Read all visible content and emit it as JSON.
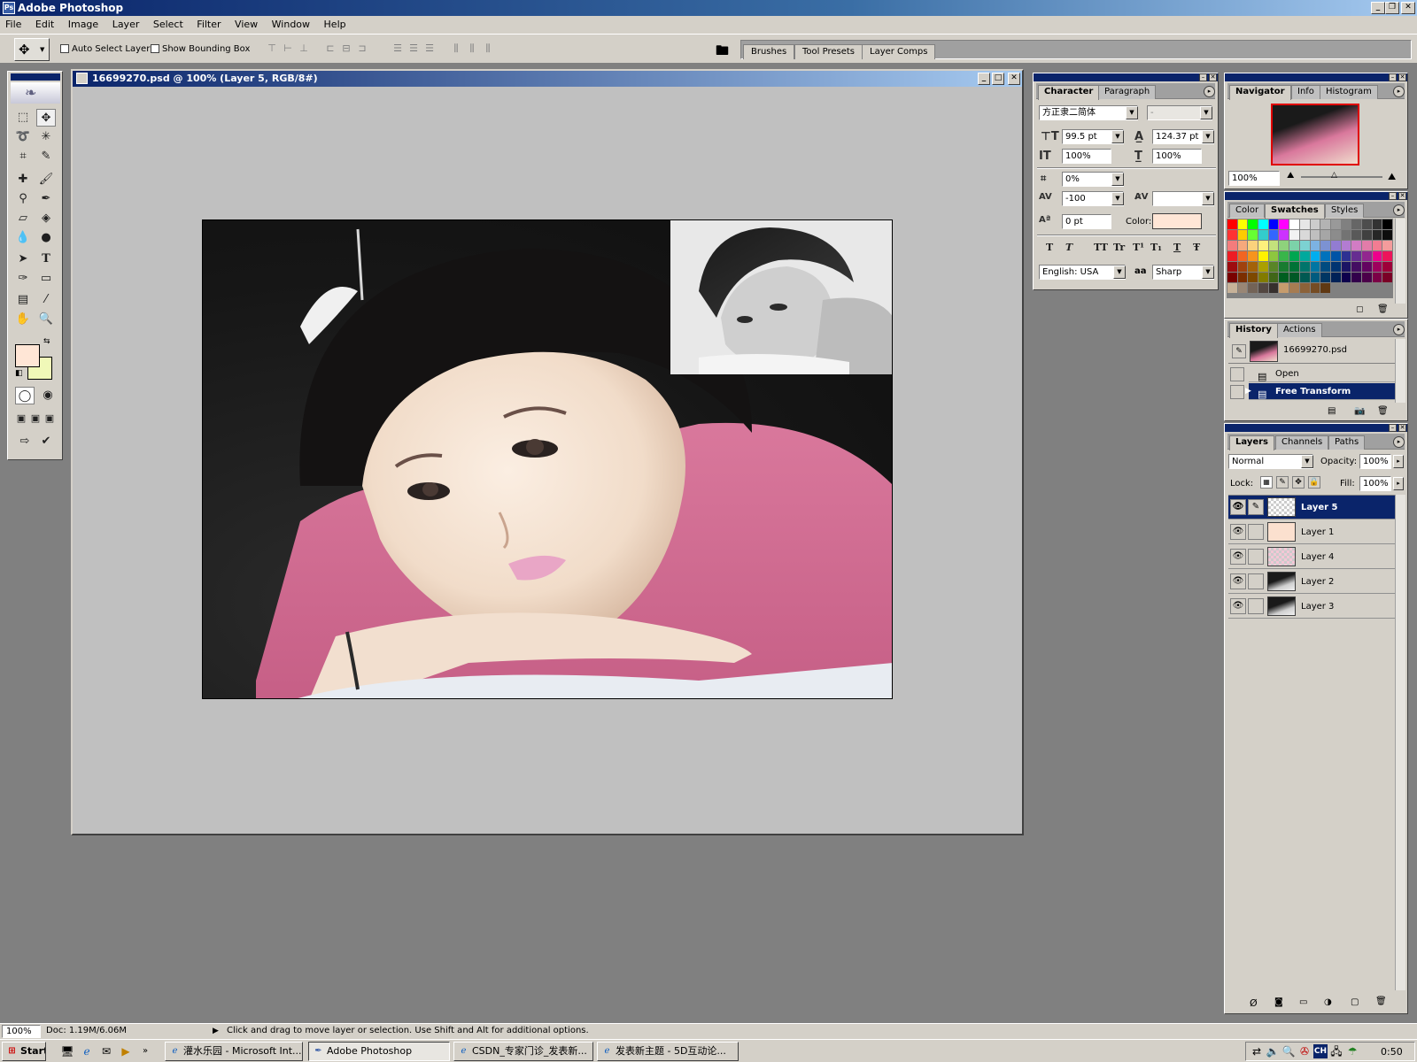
{
  "app": {
    "title": "Adobe Photoshop"
  },
  "menu": [
    "File",
    "Edit",
    "Image",
    "Layer",
    "Select",
    "Filter",
    "View",
    "Window",
    "Help"
  ],
  "options": {
    "auto_select_layer": "Auto Select Layer",
    "show_bounding_box": "Show Bounding Box"
  },
  "palette_well": [
    "Brushes",
    "Tool Presets",
    "Layer Comps"
  ],
  "document": {
    "title": "16699270.psd @ 100% (Layer 5, RGB/8#)"
  },
  "character": {
    "tabs": [
      "Character",
      "Paragraph"
    ],
    "font_family": "方正隶二简体",
    "font_style": "-",
    "size": "99.5 pt",
    "leading": "124.37 pt",
    "vscale": "100%",
    "hscale": "100%",
    "tsume": "0%",
    "tracking": "-100",
    "kerning": "",
    "baseline": "0 pt",
    "color_label": "Color:",
    "style_buttons": [
      "T",
      "T",
      "TT",
      "Tr",
      "T¹",
      "T₁",
      "T",
      "Ŧ"
    ],
    "language": "English: USA",
    "aa_label": "aa",
    "antialias": "Sharp",
    "color": "#ffe6d6"
  },
  "navigator": {
    "tabs": [
      "Navigator",
      "Info",
      "Histogram"
    ],
    "zoom": "100%"
  },
  "swatches": {
    "tabs": [
      "Color",
      "Swatches",
      "Styles"
    ],
    "colors": [
      "#ff0000",
      "#ffff00",
      "#00ff00",
      "#00ffff",
      "#0000ff",
      "#ff00ff",
      "#ffffff",
      "#e6e6e6",
      "#cccccc",
      "#b3b3b3",
      "#999999",
      "#808080",
      "#666666",
      "#4d4d4d",
      "#333333",
      "#000000",
      "#ff3333",
      "#ffcc00",
      "#66ff33",
      "#33cccc",
      "#3366ff",
      "#cc33ff",
      "#f2f2f2",
      "#d9d9d9",
      "#bfbfbf",
      "#a6a6a6",
      "#8c8c8c",
      "#737373",
      "#595959",
      "#404040",
      "#262626",
      "#0d0d0d",
      "#f47c7c",
      "#f7a97c",
      "#fbd27c",
      "#fff07c",
      "#c4e27c",
      "#8ed27c",
      "#7cd2a9",
      "#7cd2d2",
      "#7cb2e2",
      "#7c92d2",
      "#927cd2",
      "#b27cd2",
      "#d27cc4",
      "#e27ca9",
      "#f27c92",
      "#f49c9c",
      "#ed1c24",
      "#f26522",
      "#f7941d",
      "#fff200",
      "#8dc63f",
      "#39b54a",
      "#00a651",
      "#00a99d",
      "#00aeef",
      "#0072bc",
      "#0054a6",
      "#2e3192",
      "#662d91",
      "#92278f",
      "#ec008c",
      "#ed145b",
      "#9e0b0f",
      "#a0410d",
      "#a36209",
      "#aba000",
      "#598527",
      "#197b30",
      "#007236",
      "#00746b",
      "#0076a3",
      "#004b80",
      "#003471",
      "#1b1464",
      "#440e62",
      "#630460",
      "#9e005d",
      "#9e0039",
      "#790000",
      "#7b2e00",
      "#7d4900",
      "#827b00",
      "#406618",
      "#005e20",
      "#005826",
      "#005952",
      "#005b7f",
      "#003663",
      "#002157",
      "#0d004c",
      "#32004b",
      "#4b0049",
      "#7b0046",
      "#7a0026",
      "#c7b299",
      "#998675",
      "#736357",
      "#534741",
      "#362f2d",
      "#c69c6d",
      "#a67c52",
      "#8c6239",
      "#754c24",
      "#603913"
    ]
  },
  "history": {
    "tabs": [
      "History",
      "Actions"
    ],
    "snapshot": "16699270.psd",
    "items": [
      "Open",
      "Free Transform"
    ]
  },
  "layers": {
    "tabs": [
      "Layers",
      "Channels",
      "Paths"
    ],
    "blend_mode": "Normal",
    "opacity_label": "Opacity:",
    "opacity": "100%",
    "lock_label": "Lock:",
    "fill_label": "Fill:",
    "fill": "100%",
    "items": [
      "Layer 5",
      "Layer 1",
      "Layer 4",
      "Layer 2",
      "Layer 3"
    ]
  },
  "status": {
    "zoom": "100%",
    "doc": "Doc: 1.19M/6.06M",
    "hint": "Click and drag to move layer or selection.  Use Shift and Alt for additional options."
  },
  "taskbar": {
    "start": "Start",
    "items": [
      "灌水乐园 - Microsoft Int...",
      "Adobe Photoshop",
      "CSDN_专家门诊_发表新...",
      "发表新主题 - 5D互动论..."
    ],
    "clock": "0:50",
    "tray_lang": "CH"
  }
}
